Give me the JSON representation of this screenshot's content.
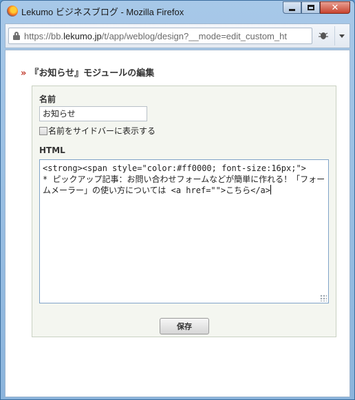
{
  "window": {
    "title": "Lekumo ビジネスブログ - Mozilla Firefox"
  },
  "urlbar": {
    "prefix": "https://bb.",
    "domain": "lekumo.jp",
    "path": "/t/app/weblog/design?__mode=edit_custom_ht"
  },
  "page": {
    "heading_marker": "»",
    "heading": "『お知らせ』モジュールの編集",
    "name_label": "名前",
    "name_value": "お知らせ",
    "show_in_sidebar_label": "名前をサイドバーに表示する",
    "show_in_sidebar_checked": false,
    "html_label": "HTML",
    "html_value": "<strong><span style=\"color:#ff0000; font-size:16px;\">\n* ピックアップ記事：お問い合わせフォームなどが簡単に作れる！「フォームメーラー」の使い方については <a href=\"\">こちら</a>",
    "save_label": "保存"
  },
  "colors": {
    "heading_marker": "#c0392b",
    "panel_bg": "#f4f6f0",
    "frame": "#8bb4dc"
  },
  "icons": [
    "firefox-logo-icon",
    "minimize-icon",
    "maximize-icon",
    "close-icon",
    "lock-icon",
    "bug-icon",
    "dropdown-arrow-icon",
    "resize-grip-icon"
  ]
}
